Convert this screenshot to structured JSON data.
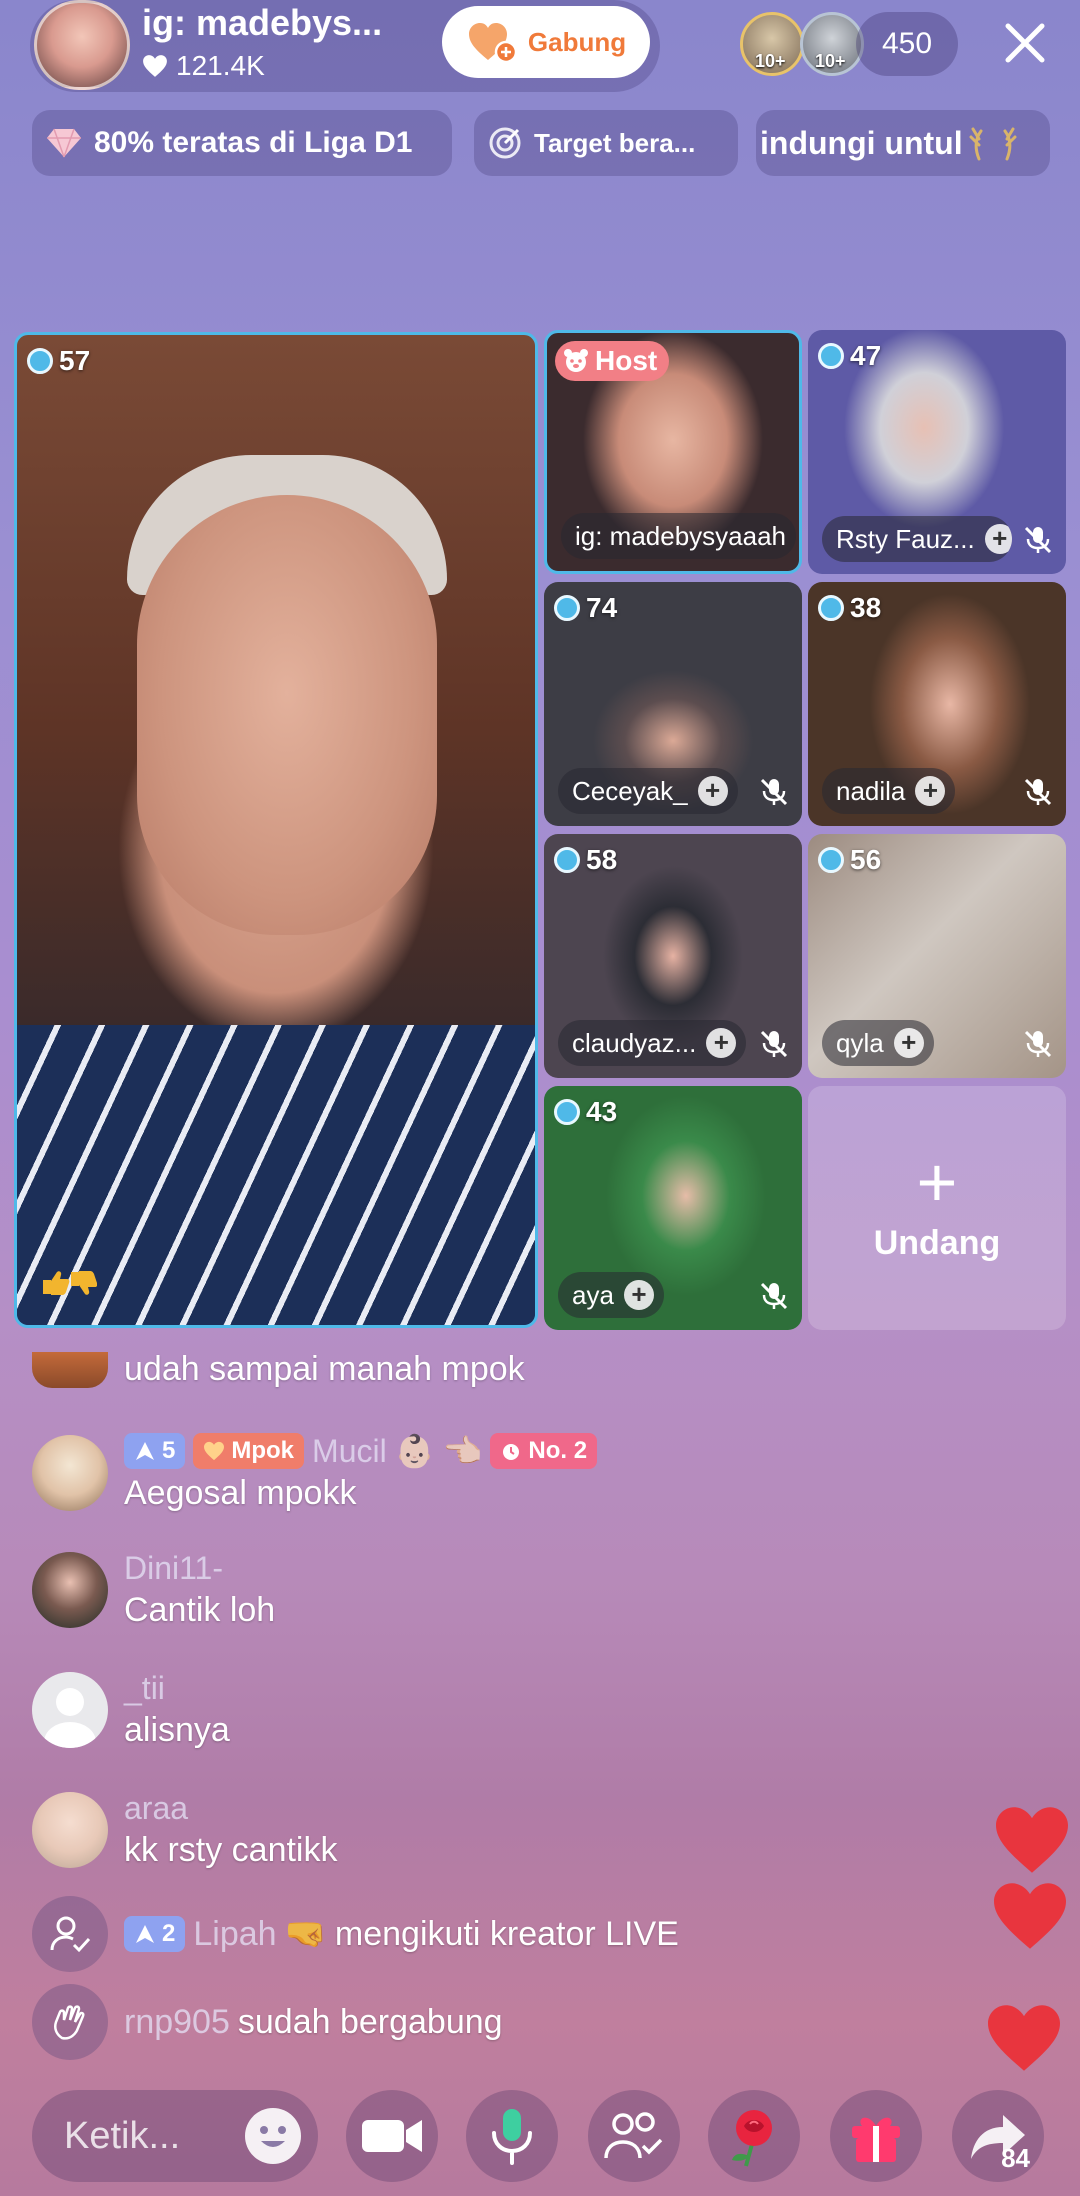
{
  "host": {
    "name": "ig: madebys...",
    "likes": "121.4K",
    "join_label": "Gabung"
  },
  "viewers": {
    "badge1": "10+",
    "badge2": "10+",
    "count": "450"
  },
  "chips": {
    "league": "80% teratas di Liga D1",
    "target": "Target bera...",
    "protect": "indungi untul"
  },
  "grid": {
    "main_score": "57",
    "host_badge": "Host",
    "host_name": "ig: madebysyaaah",
    "tiles": [
      {
        "score": "47",
        "name": "Rsty Fauz..."
      },
      {
        "score": "74",
        "name": "Ceceyak_"
      },
      {
        "score": "38",
        "name": "nadila"
      },
      {
        "score": "58",
        "name": "claudyaz..."
      },
      {
        "score": "56",
        "name": "qyla"
      },
      {
        "score": "43",
        "name": "aya"
      }
    ],
    "invite_label": "Undang"
  },
  "comments": [
    {
      "user": "",
      "message": "udah sampai manah mpok"
    },
    {
      "user": "Mucil",
      "level": "5",
      "fan_badge": "Mpok",
      "rank_badge": "No. 2",
      "message": "Aegosal mpokk"
    },
    {
      "user": "Dini11-",
      "message": "Cantik loh"
    },
    {
      "user": "_tii",
      "message": "alisnya"
    },
    {
      "user": "araa",
      "message": "kk rsty cantikk"
    },
    {
      "user": "Lipah",
      "level": "2",
      "message": "mengikuti kreator LIVE"
    },
    {
      "user": "rnp905",
      "message": "sudah bergabung"
    }
  ],
  "bottom_bar": {
    "input_placeholder": "Ketik...",
    "share_count": "84"
  },
  "colors": {
    "accent_blue": "#4fb9e8",
    "host_badge": "#f27f86",
    "like_heart": "#e8353e",
    "join_text": "#f07a3a"
  }
}
